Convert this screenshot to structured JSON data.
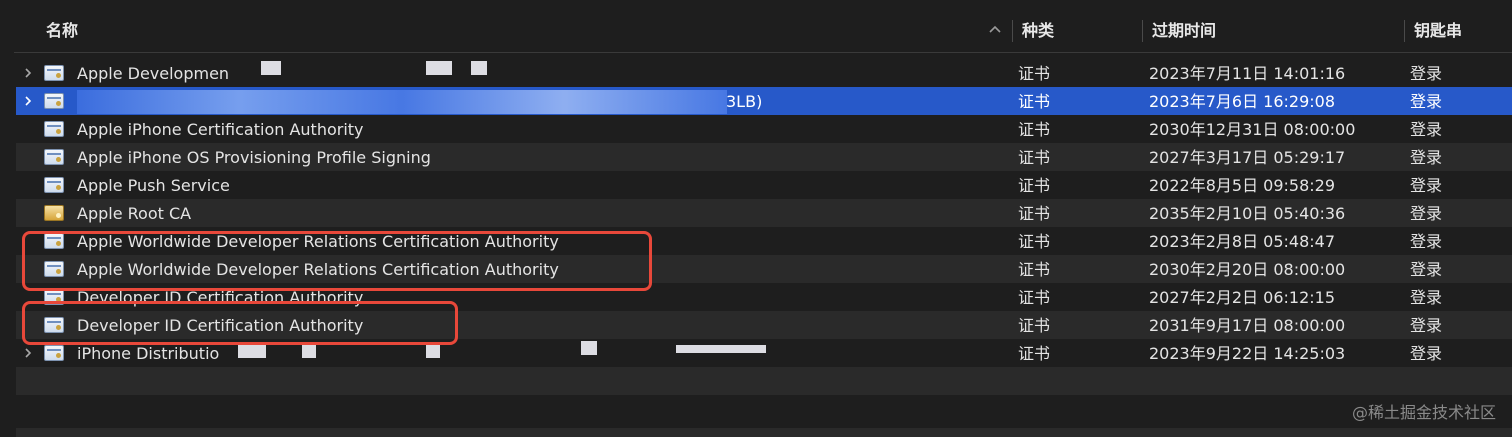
{
  "header": {
    "name": "名称",
    "kind": "种类",
    "expires": "过期时间",
    "keychain": "钥匙串"
  },
  "colors": {
    "selected": "#2759c9",
    "highlight": "#e8483a"
  },
  "rows": [
    {
      "name": "Apple Developmen",
      "kind": "证书",
      "expires": "2023年7月11日 14:01:16",
      "keychain": "登录",
      "icon": "certificate-icon",
      "expandable": true
    },
    {
      "name": "3LB)",
      "kind": "证书",
      "expires": "2023年7月6日 16:29:08",
      "keychain": "登录",
      "icon": "certificate-icon",
      "expandable": true,
      "selected": true
    },
    {
      "name": "Apple iPhone Certification Authority",
      "kind": "证书",
      "expires": "2030年12月31日 08:00:00",
      "keychain": "登录",
      "icon": "certificate-icon"
    },
    {
      "name": "Apple iPhone OS Provisioning Profile Signing",
      "kind": "证书",
      "expires": "2027年3月17日 05:29:17",
      "keychain": "登录",
      "icon": "certificate-icon"
    },
    {
      "name": "Apple Push Service",
      "kind": "证书",
      "expires": "2022年8月5日 09:58:29",
      "keychain": "登录",
      "icon": "certificate-icon"
    },
    {
      "name": "Apple Root CA",
      "kind": "证书",
      "expires": "2035年2月10日 05:40:36",
      "keychain": "登录",
      "icon": "root-certificate-icon"
    },
    {
      "name": "Apple Worldwide Developer Relations Certification Authority",
      "kind": "证书",
      "expires": "2023年2月8日 05:48:47",
      "keychain": "登录",
      "icon": "certificate-icon"
    },
    {
      "name": "Apple Worldwide Developer Relations Certification Authority",
      "kind": "证书",
      "expires": "2030年2月20日 08:00:00",
      "keychain": "登录",
      "icon": "certificate-icon"
    },
    {
      "name": "Developer ID Certification Authority",
      "kind": "证书",
      "expires": "2027年2月2日 06:12:15",
      "keychain": "登录",
      "icon": "certificate-icon"
    },
    {
      "name": "Developer ID Certification Authority",
      "kind": "证书",
      "expires": "2031年9月17日 08:00:00",
      "keychain": "登录",
      "icon": "certificate-icon"
    },
    {
      "name": "iPhone Distributio",
      "kind": "证书",
      "expires": "2023年9月22日 14:25:03",
      "keychain": "登录",
      "icon": "certificate-icon",
      "expandable": true
    }
  ],
  "watermark": "@稀土掘金技术社区"
}
